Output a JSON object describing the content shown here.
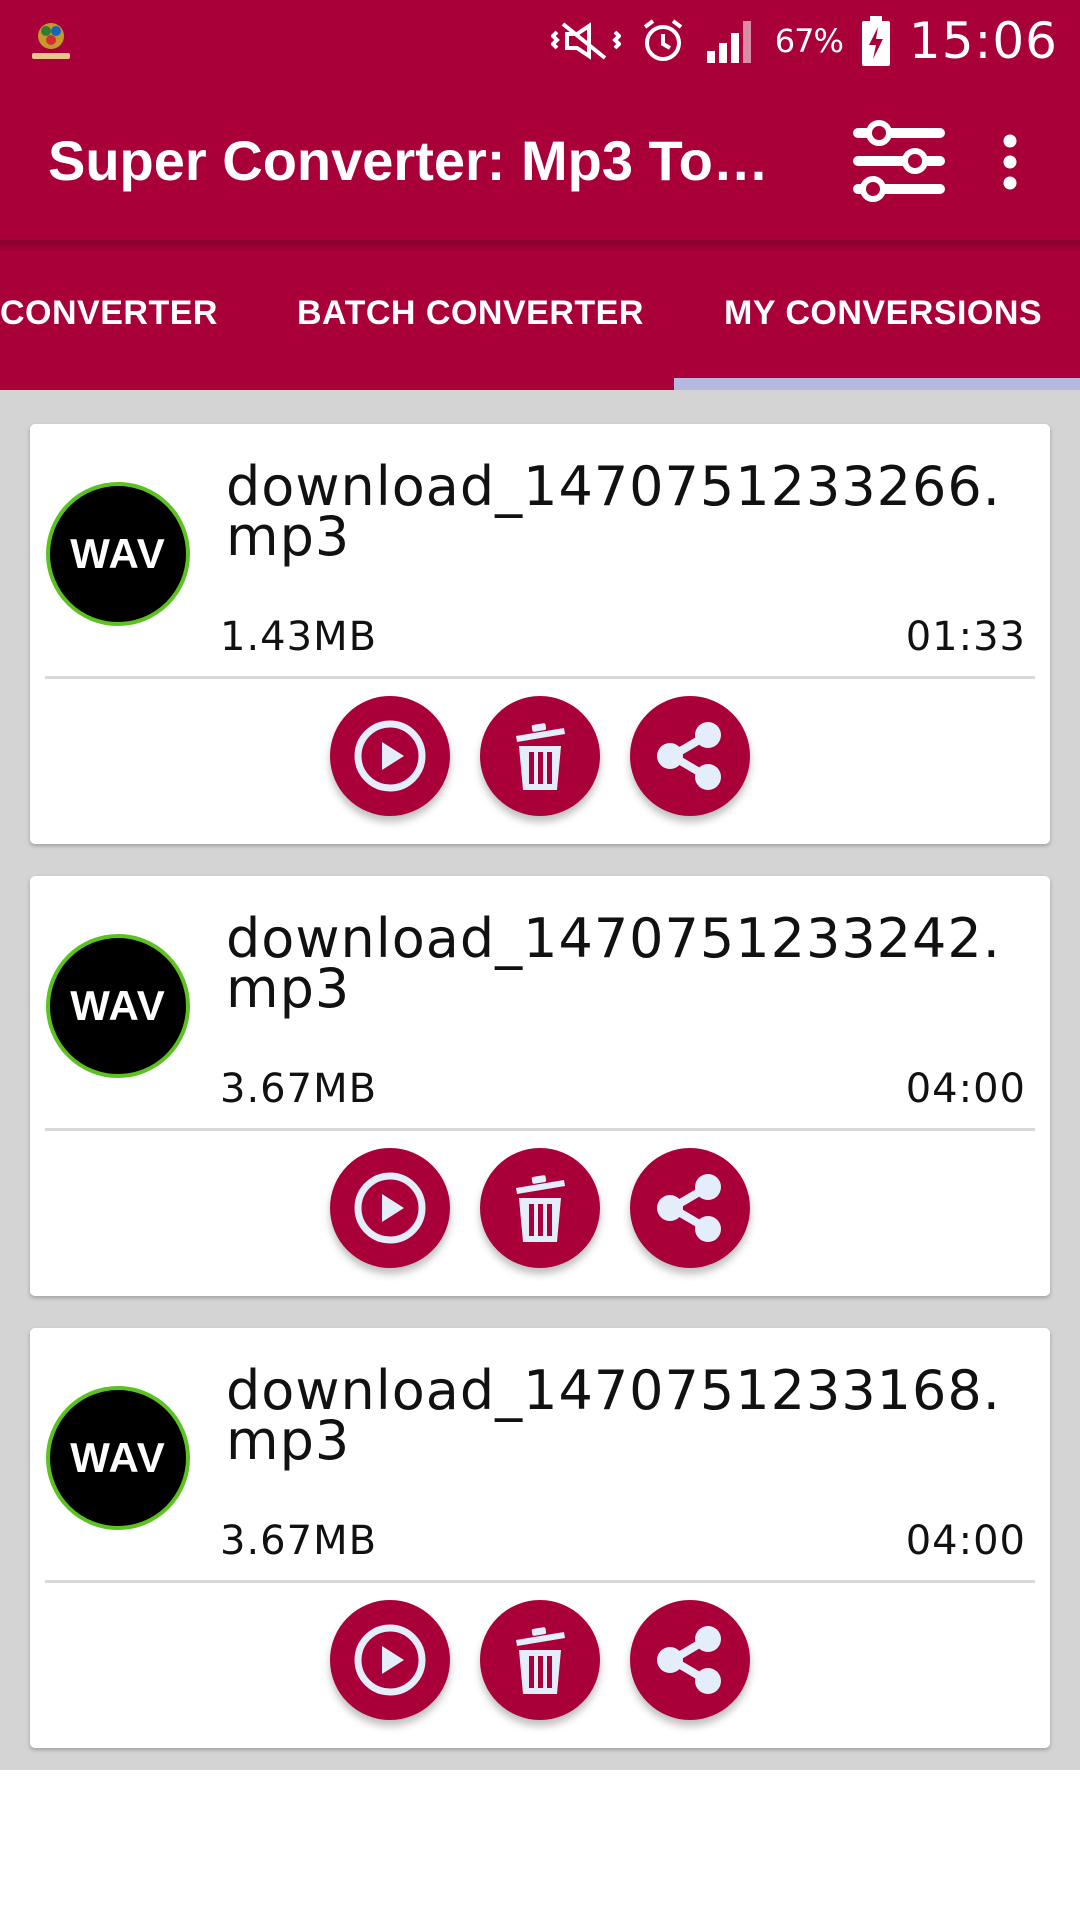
{
  "status_bar": {
    "battery_percent": "67%",
    "time": "15:06",
    "icons": [
      "app-logo-icon",
      "vibrate-mute-icon",
      "alarm-icon",
      "signal-icon",
      "battery-charging-icon"
    ]
  },
  "toolbar": {
    "title": "Super Converter: Mp3 To…",
    "icons": [
      "settings-sliders-icon",
      "more-vert-icon"
    ]
  },
  "tabs": [
    {
      "label": "CONVERTER",
      "selected": false
    },
    {
      "label": "BATCH CONVERTER",
      "selected": false
    },
    {
      "label": "MY CONVERSIONS",
      "selected": true
    }
  ],
  "conversions": [
    {
      "badge": "WAV",
      "name": "download_1470751233266.mp3",
      "size": "1.43MB",
      "duration": "01:33"
    },
    {
      "badge": "WAV",
      "name": "download_1470751233242.mp3",
      "size": "3.67MB",
      "duration": "04:00"
    },
    {
      "badge": "WAV",
      "name": "download_1470751233168.mp3",
      "size": "3.67MB",
      "duration": "04:00"
    }
  ],
  "card_actions": [
    "play-icon",
    "trash-icon",
    "share-icon"
  ],
  "colors": {
    "primary": "#a9003a",
    "tab_indicator": "#b5b9e0",
    "badge_ring": "#5cc21f",
    "list_background": "#d4d4d4"
  }
}
